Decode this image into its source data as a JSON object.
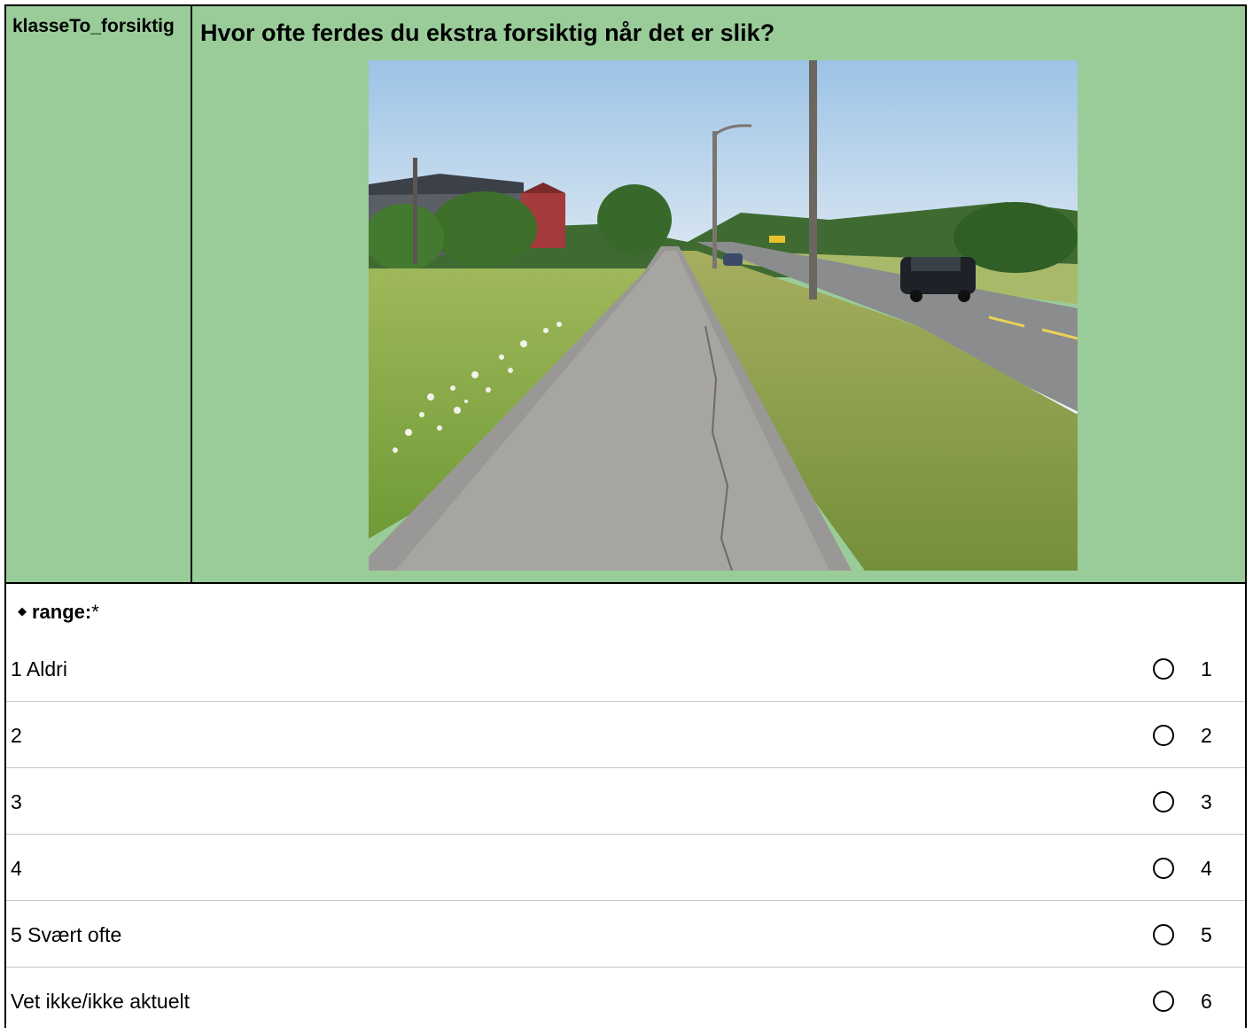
{
  "variable_name": "klasseTo_forsiktig",
  "question": "Hvor ofte ferdes du ekstra forsiktig når det er slik?",
  "range_label": "range:",
  "required_mark": "*",
  "options": [
    {
      "label": "1 Aldri",
      "code": "1"
    },
    {
      "label": "2",
      "code": "2"
    },
    {
      "label": "3",
      "code": "3"
    },
    {
      "label": "4",
      "code": "4"
    },
    {
      "label": "5 Svært ofte",
      "code": "5"
    },
    {
      "label": "Vet ikke/ikke aktuelt",
      "code": "6"
    }
  ],
  "colors": {
    "header_bg": "#99cc99",
    "border": "#000000",
    "row_divider": "#c8c8c8"
  },
  "icons": {
    "bullet": "diamond-icon",
    "option": "radio-circle-icon"
  }
}
